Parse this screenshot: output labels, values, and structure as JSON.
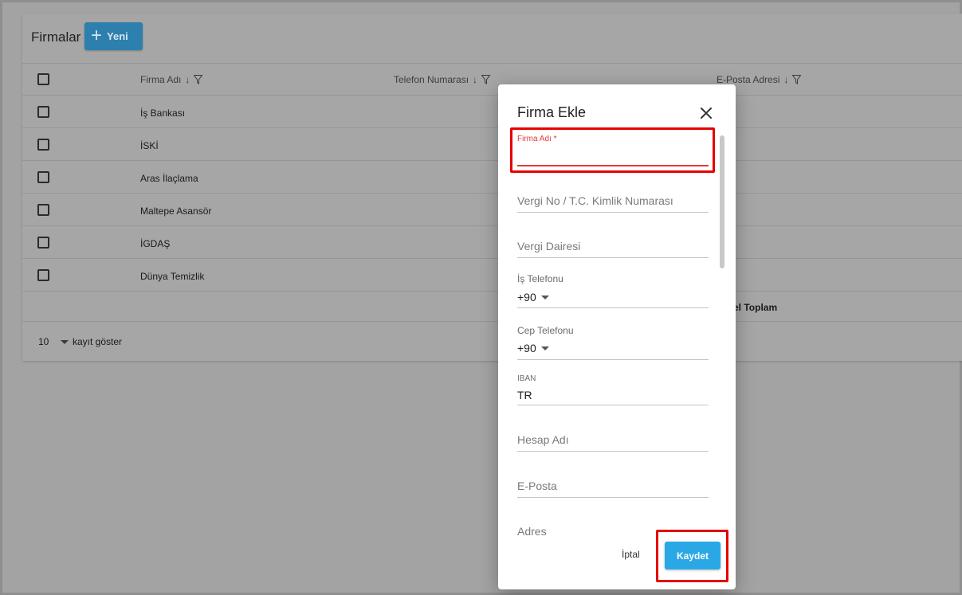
{
  "page": {
    "title": "Firmalar",
    "new_button": "Yeni",
    "columns": [
      "Firma Adı",
      "Telefon Numarası",
      "E-Posta Adresi"
    ],
    "rows": [
      {
        "name": "İş Bankası"
      },
      {
        "name": "İSKİ"
      },
      {
        "name": "Aras İlaçlama"
      },
      {
        "name": "Maltepe Asansör"
      },
      {
        "name": "İGDAŞ"
      },
      {
        "name": "Dünya Temizlik"
      }
    ],
    "total_label": "el Toplam",
    "footer": {
      "page_size": "10",
      "page_size_label": "kayıt göster"
    }
  },
  "dialog": {
    "title": "Firma Ekle",
    "fields": {
      "company_name_label": "Firma Adı *",
      "tax_no_placeholder": "Vergi No / T.C. Kimlik Numarası",
      "tax_office_placeholder": "Vergi Dairesi",
      "work_phone_label": "İş Telefonu",
      "work_phone_prefix": "+90",
      "mobile_phone_label": "Cep Telefonu",
      "mobile_phone_prefix": "+90",
      "iban_label": "IBAN",
      "iban_value": "TR",
      "account_name_placeholder": "Hesap Adı",
      "email_placeholder": "E-Posta",
      "address_placeholder": "Adres"
    },
    "cancel_label": "İptal",
    "save_label": "Kaydet"
  },
  "colors": {
    "overlay": "#a3a3a3",
    "primary": "#2aa8e6",
    "highlight": "#e60000",
    "required": "#e53935"
  }
}
